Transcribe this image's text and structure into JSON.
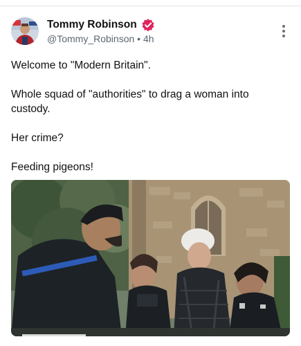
{
  "post": {
    "author_name": "Tommy Robinson",
    "handle": "@Tommy_Robinson",
    "separator": "•",
    "time": "4h",
    "verified_color": "#e0245e",
    "icons": {
      "verified": "verified-badge-icon",
      "more": "more-options-icon"
    },
    "paragraphs": [
      "Welcome to \"Modern Britain\".",
      "Whole squad of \"authorities\" to drag a woman into custody.",
      "Her crime?",
      "Feeding pigeons!"
    ]
  },
  "media": {
    "type": "video"
  }
}
